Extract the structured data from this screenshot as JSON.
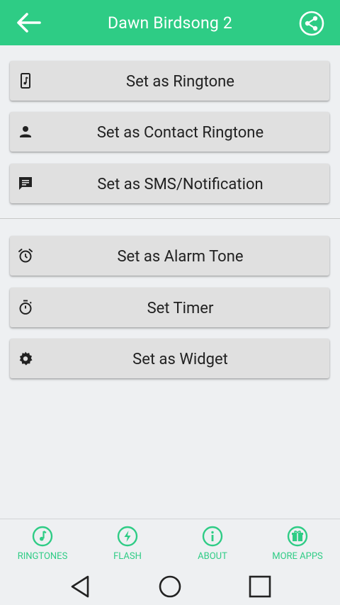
{
  "app_bar": {
    "title": "Dawn Birdsong 2",
    "back_icon": "arrow-back-icon",
    "share_icon": "share-icon"
  },
  "actions": {
    "group1": [
      {
        "label": "Set as Ringtone",
        "icon": "music-file-icon"
      },
      {
        "label": "Set as Contact Ringtone",
        "icon": "person-icon"
      },
      {
        "label": "Set as SMS/Notification",
        "icon": "message-icon"
      }
    ],
    "group2": [
      {
        "label": "Set as Alarm Tone",
        "icon": "alarm-icon"
      },
      {
        "label": "Set Timer",
        "icon": "timer-icon"
      },
      {
        "label": "Set as Widget",
        "icon": "gear-icon"
      }
    ]
  },
  "bottom_nav": [
    {
      "label": "RINGTONES",
      "icon": "music-note-icon"
    },
    {
      "label": "FLASH",
      "icon": "flash-icon"
    },
    {
      "label": "ABOUT",
      "icon": "info-icon"
    },
    {
      "label": "MORE APPS",
      "icon": "gift-icon"
    }
  ],
  "system_nav": [
    "back-triangle-icon",
    "home-circle-icon",
    "recents-square-icon"
  ],
  "colors": {
    "accent": "#2ecc85",
    "background": "#eef0f2",
    "button": "#e0e0e0",
    "text": "#212121"
  }
}
